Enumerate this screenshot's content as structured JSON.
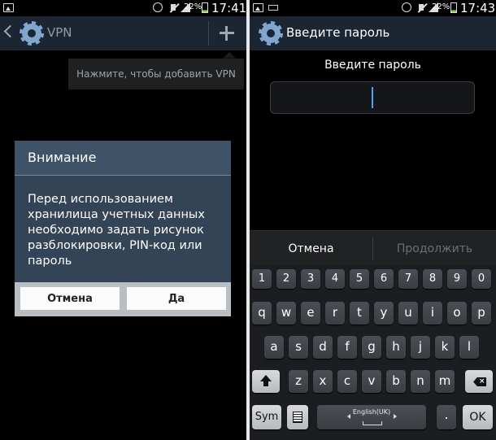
{
  "left": {
    "status": {
      "battery": "22%",
      "time": "17:41"
    },
    "header": {
      "title": "VPN"
    },
    "tooltip": "Нажмите, чтобы добавить VPN",
    "dialog": {
      "title": "Внимание",
      "message": "Перед использованием хранилища учетных данных необходимо задать рисунок разблокировки, PIN-код или пароль",
      "cancel": "Отмена",
      "ok": "Да"
    }
  },
  "right": {
    "status": {
      "battery": "22%",
      "time": "17:43"
    },
    "header": {
      "title": "Введите пароль"
    },
    "password_label": "Введите пароль",
    "password_value": "",
    "buttons": {
      "cancel": "Отмена",
      "continue": "Продолжить"
    },
    "keyboard": {
      "row_num": [
        "1",
        "2",
        "3",
        "4",
        "5",
        "6",
        "7",
        "8",
        "9",
        "0"
      ],
      "row1": [
        "q",
        "w",
        "e",
        "r",
        "t",
        "y",
        "u",
        "i",
        "o",
        "p"
      ],
      "row2": [
        "a",
        "s",
        "d",
        "f",
        "g",
        "h",
        "j",
        "k",
        "l"
      ],
      "row3": [
        "z",
        "x",
        "c",
        "v",
        "b",
        "n",
        "m"
      ],
      "sym": "Sym",
      "space_lang": "English(UK)",
      "period": ".",
      "ok": "OK"
    }
  },
  "colors": {
    "action_bar": "#1c2632",
    "dialog": "#324456",
    "caret": "#4ea2ff",
    "disabled_text": "#6b6f74"
  }
}
